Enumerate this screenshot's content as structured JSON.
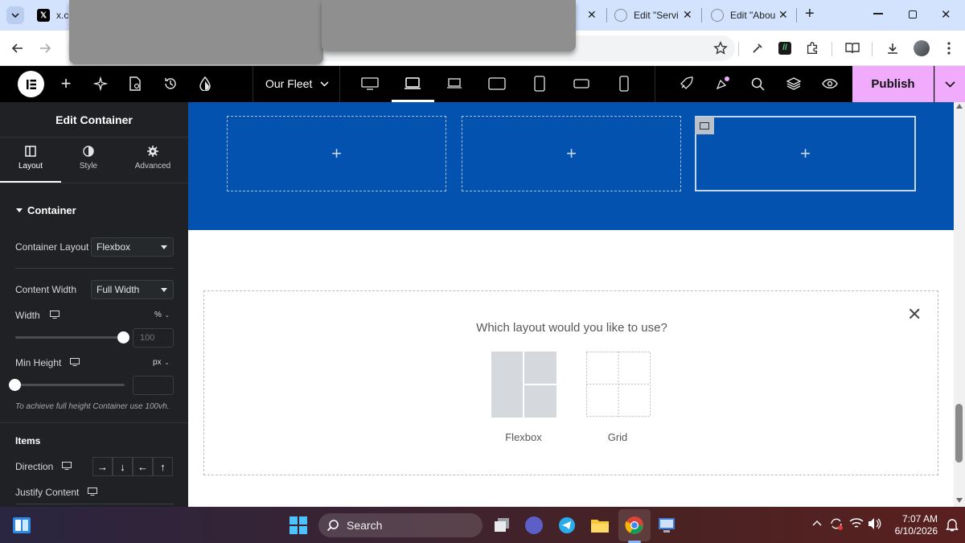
{
  "browser": {
    "tabs": [
      {
        "label": "x.co"
      },
      {
        "label": "Edit \"Servi"
      },
      {
        "label": "Edit \"Abou"
      }
    ],
    "new_tab_symbol": "+",
    "window_minimize": "—",
    "window_close": "✕"
  },
  "topbar": {
    "page_name": "Our Fleet",
    "publish_label": "Publish",
    "accent_color": "#f0abfc"
  },
  "sidebar": {
    "title": "Edit Container",
    "tabs": [
      {
        "label": "Layout"
      },
      {
        "label": "Style"
      },
      {
        "label": "Advanced"
      }
    ],
    "section_title": "Container",
    "container_layout": {
      "label": "Container Layout",
      "value": "Flexbox"
    },
    "content_width": {
      "label": "Content Width",
      "value": "Full Width"
    },
    "width": {
      "label": "Width",
      "unit": "%",
      "placeholder": "100",
      "fill_fraction": 1.0
    },
    "min_height": {
      "label": "Min Height",
      "unit": "px",
      "placeholder": "",
      "fill_fraction": 0.0
    },
    "hint": "To achieve full height Container use 100vh.",
    "items_title": "Items",
    "direction_label": "Direction",
    "direction_arrows": [
      "→",
      "↓",
      "←",
      "↑"
    ],
    "justify_label": "Justify Content"
  },
  "canvas": {
    "section_color": "#0352b0",
    "plus_symbol": "+",
    "layout_question": "Which layout would you like to use?",
    "options": [
      {
        "label": "Flexbox"
      },
      {
        "label": "Grid"
      }
    ],
    "close_symbol": "✕"
  },
  "taskbar": {
    "search_label": "Search",
    "time": "7:07 AM",
    "date": "6/10/2026"
  }
}
